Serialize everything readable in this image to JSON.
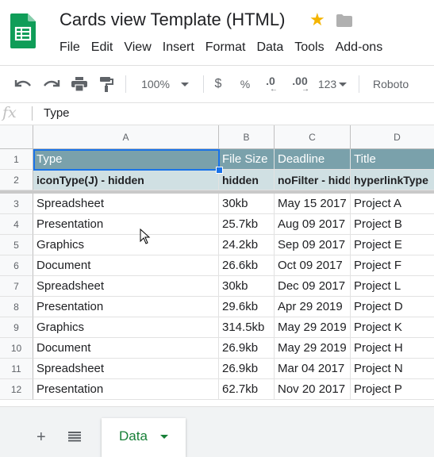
{
  "document": {
    "title": "Cards view Template (HTML)"
  },
  "menu": [
    "File",
    "Edit",
    "View",
    "Insert",
    "Format",
    "Data",
    "Tools",
    "Add-ons"
  ],
  "toolbar": {
    "zoom": "100%",
    "currency": "$",
    "percent": "%",
    "decrease_decimal": ".0",
    "increase_decimal": ".00",
    "more_formats": "123",
    "font": "Roboto",
    "icons": [
      "undo-icon",
      "redo-icon",
      "print-icon",
      "paint-format-icon"
    ]
  },
  "formula_bar": {
    "fx": "fx",
    "value": "Type"
  },
  "grid": {
    "columns": [
      "A",
      "B",
      "C",
      "D"
    ],
    "rows": [
      {
        "num": "1",
        "cells": [
          "Type",
          "File Size",
          "Deadline",
          "Title"
        ]
      },
      {
        "num": "2",
        "cells": [
          "iconType(J) - hidden",
          "hidden",
          "noFilter - hidden",
          "hyperlinkType"
        ]
      },
      {
        "num": "3",
        "cells": [
          "Spreadsheet",
          "30kb",
          "May 15 2017",
          "Project A"
        ]
      },
      {
        "num": "4",
        "cells": [
          "Presentation",
          "25.7kb",
          "Aug 09 2017",
          "Project B"
        ]
      },
      {
        "num": "5",
        "cells": [
          "Graphics",
          "24.2kb",
          "Sep 09 2017",
          "Project E"
        ]
      },
      {
        "num": "6",
        "cells": [
          "Document",
          "26.6kb",
          "Oct 09 2017",
          "Project F"
        ]
      },
      {
        "num": "7",
        "cells": [
          "Spreadsheet",
          "30kb",
          "Dec 09 2017",
          "Project L"
        ]
      },
      {
        "num": "8",
        "cells": [
          "Presentation",
          "29.6kb",
          "Apr 29 2019",
          "Project D"
        ]
      },
      {
        "num": "9",
        "cells": [
          "Graphics",
          "314.5kb",
          "May 29 2019",
          "Project K"
        ]
      },
      {
        "num": "10",
        "cells": [
          "Document",
          "26.9kb",
          "May 29 2019",
          "Project H"
        ]
      },
      {
        "num": "11",
        "cells": [
          "Spreadsheet",
          "26.9kb",
          "Mar 04 2017",
          "Project N"
        ]
      },
      {
        "num": "12",
        "cells": [
          "Presentation",
          "62.7kb",
          "Nov 20 2017",
          "Project P"
        ]
      }
    ]
  },
  "sheets": {
    "add": "+",
    "active": "Data"
  },
  "colors": {
    "header_row": "#7aa1ab",
    "subheader_row": "#d0e0e3",
    "selection": "#1a73e8",
    "sheet_tab": "#188038",
    "logo": "#0f9d58",
    "star": "#f4b400"
  }
}
